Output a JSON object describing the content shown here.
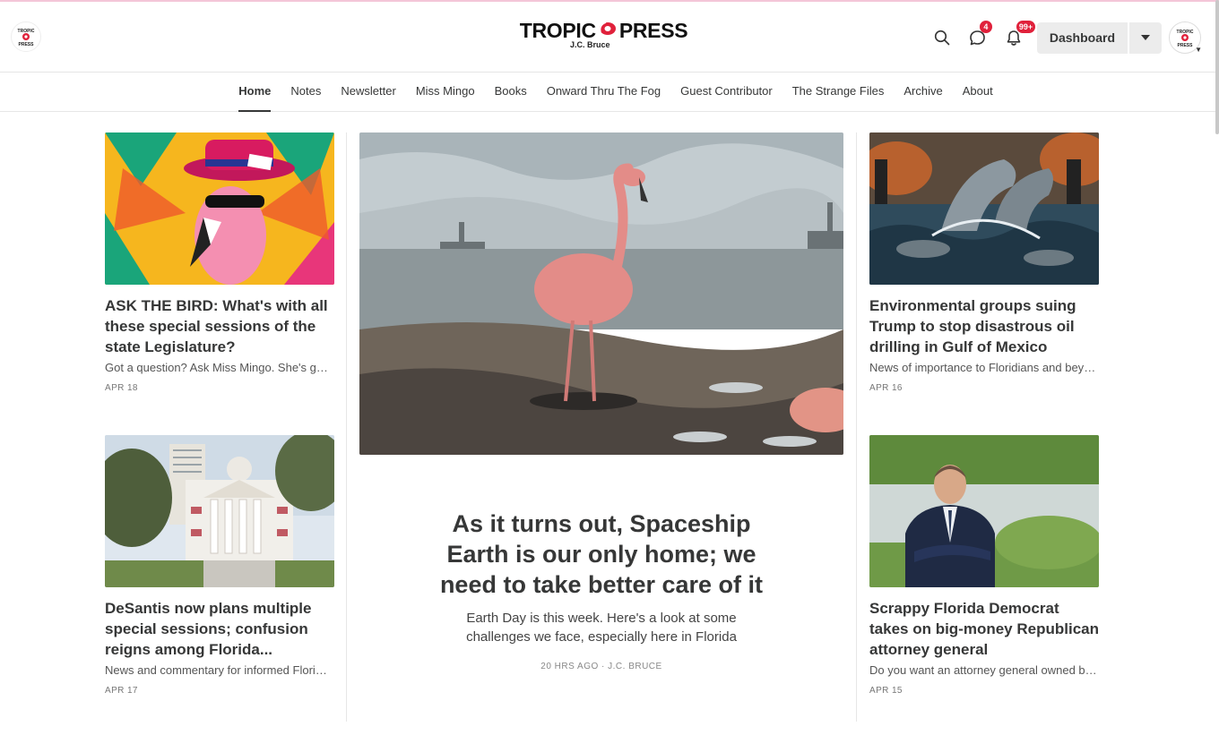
{
  "header": {
    "brand_name_left": "TROPIC",
    "brand_name_right": "PRESS",
    "brand_author": "J.C. Bruce",
    "messages_badge": "4",
    "notifications_badge": "99+",
    "dashboard_label": "Dashboard",
    "accent_color": "#e0213b"
  },
  "nav": {
    "items": [
      "Home",
      "Notes",
      "Newsletter",
      "Miss Mingo",
      "Books",
      "Onward Thru The Fog",
      "Guest Contributor",
      "The Strange Files",
      "Archive",
      "About"
    ],
    "active": "Home"
  },
  "feature": {
    "title": "As it turns out, Spaceship Earth is our only home; we need to take better care of it",
    "subtitle": "Earth Day is this week. Here's a look at some challenges we face, especially here in Florida",
    "meta": "20 HRS AGO · J.C. BRUCE"
  },
  "posts": [
    {
      "title": "ASK THE BIRD: What's with all these special sessions of the state Legislature?",
      "subtitle": "Got a question? Ask Miss Mingo. She's got answers.",
      "date": "APR 18"
    },
    {
      "title": "DeSantis now plans multiple special sessions; confusion reigns among Florida...",
      "subtitle": "News and commentary for informed Floridians",
      "date": "APR 17"
    },
    {
      "title": "Environmental groups suing Trump to stop disastrous oil drilling in Gulf of Mexico",
      "subtitle": "News of importance to Floridians and beyond",
      "date": "APR 16"
    },
    {
      "title": "Scrappy Florida Democrat takes on big-money Republican attorney general",
      "subtitle": "Do you want an attorney general owned by big money?",
      "date": "APR 15"
    }
  ]
}
